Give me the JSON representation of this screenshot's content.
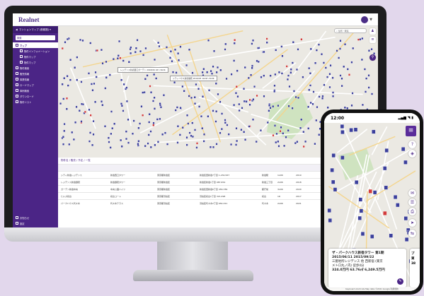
{
  "desktop": {
    "app_title": "Realnet",
    "sidebar": {
      "project_select": "マンションマップ (首都圏) ▾",
      "search_label": "検索",
      "section_label": "マップ",
      "items": [
        {
          "label": "物件インフォメーション",
          "sub": true,
          "active": false
        },
        {
          "label": "物件マップ",
          "sub": true,
          "active": false
        },
        {
          "label": "物件マップ",
          "sub": true,
          "active": false
        },
        {
          "label": "物件検索",
          "sub": false,
          "active": false
        },
        {
          "label": "販売情報",
          "sub": false,
          "active": false
        },
        {
          "label": "事業情報",
          "sub": false,
          "active": false
        },
        {
          "label": "ロードマップ",
          "sub": false,
          "active": false
        },
        {
          "label": "事例検索",
          "sub": false,
          "active": false
        },
        {
          "label": "ダウンロード",
          "sub": false,
          "active": false
        },
        {
          "label": "物件リスト",
          "sub": false,
          "active": false
        }
      ],
      "bottom_items": [
        {
          "label": "お知らせ"
        },
        {
          "label": "設定"
        }
      ]
    },
    "map": {
      "search_placeholder": "住所・駅名",
      "popups": [
        "レジデンス新宿西口ガーデン 2018/06 1R〜3LDK",
        "シティハウス新宿御苑 2019/03 1LDK〜3LDK"
      ]
    },
    "table": {
      "title": "物件名 / 販売 / 予定 / 一覧",
      "count": "2,408 / 2,408 件",
      "rows": [
        [
          "シティ新宿レジデンス",
          "新宿西口タワー",
          "東京都新宿区",
          "新宿区西新宿7丁目 1,234,567",
          "新宿駅",
          "1LDK",
          "2019",
          ""
        ],
        [
          "レジデンス新宿御苑",
          "新宿御苑タワー",
          "東京都新宿区",
          "新宿区新宿1丁目 987,654",
          "新宿三丁目",
          "2LDK",
          "2018",
          ""
        ],
        [
          "ガーデン新宿中央",
          "中央公園ハイツ",
          "東京都新宿区",
          "新宿区西新宿6丁目 456,789",
          "都庁前",
          "3LDK",
          "2020",
          ""
        ],
        [
          "ヒルズ初台",
          "初台コート",
          "東京都渋谷区",
          "渋谷区初台1丁目 321,098",
          "初台",
          "1R",
          "2017",
          ""
        ],
        [
          "パークハウス代々木",
          "代々木テラス",
          "東京都渋谷区",
          "渋谷区代々木2丁目 654,321",
          "代々木",
          "2LDK",
          "2021",
          ""
        ]
      ]
    }
  },
  "phone": {
    "status_time": "12:00",
    "status_icons": "▂▄▆ ◥ ▮",
    "card": {
      "name": "ザ・パークハウス新宿タワー 第1期",
      "dates": "2015/06/11 2015/09/22",
      "developer": "三菱地所レジデンス 他 西新宿 (東京",
      "station": "メトロ丸ノ内) 徒歩4分",
      "price": "324.0万円 63.76㎡ 6,249.5万円"
    },
    "card2_lines": [
      "プ",
      "東",
      "38"
    ],
    "footer": "Keyboard shortcuts  Map data ©2021 Google  利用規約"
  },
  "colors": {
    "brand_purple": "#4b2586",
    "marker": "#3b3f9c",
    "marker_red": "#d23b3b",
    "park_green": "#cfe3c0",
    "background": "#e2d7ec"
  }
}
